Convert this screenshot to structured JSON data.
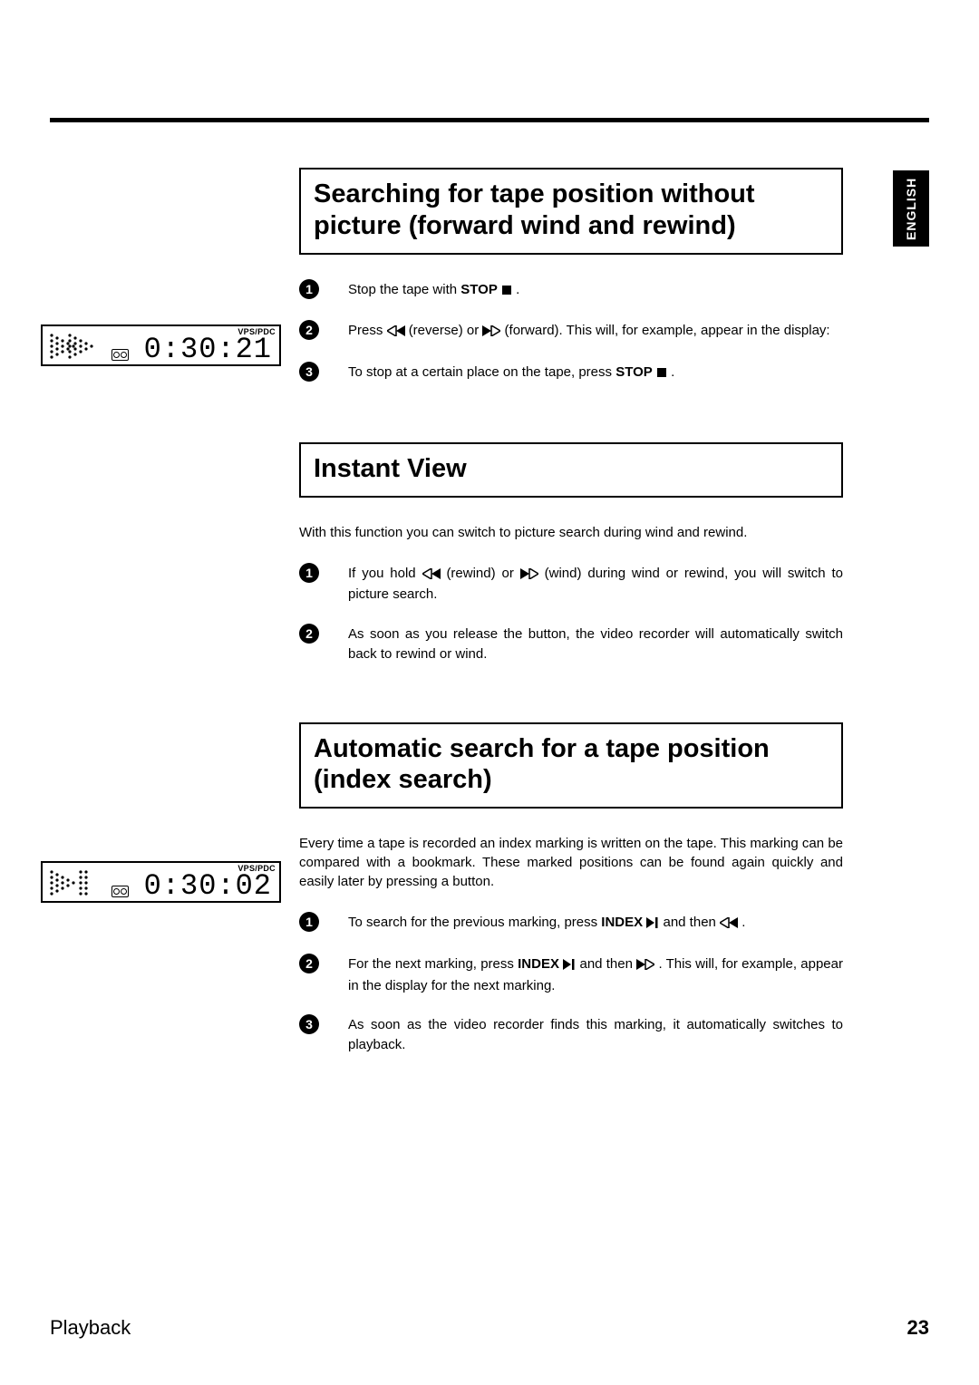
{
  "lang_tab": "ENGLISH",
  "sections": {
    "search_no_pic": {
      "title": "Searching for tape position without picture (forward wind and rewind)",
      "steps": {
        "s1": {
          "pre": "Stop the tape with ",
          "btn": "STOP",
          "post": " ."
        },
        "s2": {
          "pre": "Press ",
          "mid1": " (reverse) or ",
          "mid2": " (forward). This will, for example, appear in the display:"
        },
        "s3": {
          "pre": "To stop at a certain place on the tape, press ",
          "btn": "STOP",
          "post": " ."
        }
      }
    },
    "instant_view": {
      "title": "Instant View",
      "intro": "With this function you can switch to picture search during wind and rewind.",
      "steps": {
        "s1": {
          "pre": "If you hold ",
          "mid1": " (rewind) or ",
          "mid2": " (wind) during wind or rewind, you will switch to picture search."
        },
        "s2": "As soon as you release the button, the video recorder will automatically switch back to rewind or wind."
      }
    },
    "index_search": {
      "title": "Automatic search for a tape position (index search)",
      "intro": "Every time a tape is recorded an index marking is written on the tape. This marking can be compared with a bookmark. These marked positions can be found again quickly and easily later by pressing a button.",
      "steps": {
        "s1": {
          "pre": "To search for the previous marking, press ",
          "btn": "INDEX",
          "mid": " and then ",
          "post": " ."
        },
        "s2": {
          "pre": "For the next marking, press ",
          "btn": "INDEX",
          "mid": " and then ",
          "post": " . This will, for example, appear in the display for the next marking."
        },
        "s3": "As soon as the video recorder finds this marking, it automatically switches to playback."
      }
    }
  },
  "displays": {
    "d1": {
      "vps": "VPS/PDC",
      "time": "0:30:21"
    },
    "d2": {
      "vps": "VPS/PDC",
      "time": "0:30:02"
    }
  },
  "footer": {
    "section": "Playback",
    "page": "23"
  },
  "nums": {
    "n1": "1",
    "n2": "2",
    "n3": "3"
  }
}
